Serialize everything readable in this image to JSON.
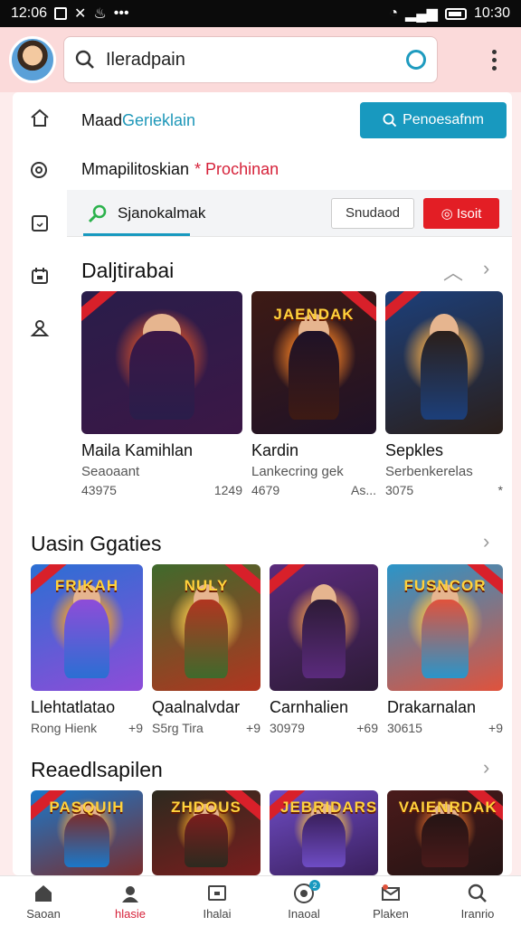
{
  "status_bar": {
    "time_left": "12:06",
    "time": "10:30",
    "dots": "•••"
  },
  "search": {
    "query": "Ileradpain"
  },
  "rail": {
    "items": [
      "home-icon",
      "search-icon",
      "tablet-icon",
      "calendar-icon",
      "user-icon"
    ]
  },
  "header_rows": {
    "row1_prefix": "Maad",
    "row1_link": "Gerieklain",
    "row1_button": "Penoesafnm",
    "row2_label": "Mmapilitoskian",
    "row2_red": "* Prochinan",
    "row3_label": "Sjanokalmak",
    "row3_btn_white": "Snudaod",
    "row3_btn_red": "Isoit"
  },
  "sections": [
    {
      "title": "Daljtirabai",
      "cards": [
        {
          "name": "Maila Kamihlan",
          "sub": "Seaoaant",
          "stat_left": "43975",
          "stat_right": "1249",
          "thumb_title": "",
          "colors": [
            "#2a1d4a",
            "#d6512b",
            "#3b1746"
          ]
        },
        {
          "name": "Kardin",
          "sub": "Lankecring gek",
          "stat_left": "4679",
          "stat_right": "As...",
          "thumb_title": "JAENDAK",
          "colors": [
            "#3d1a14",
            "#ec7b24",
            "#1f1227"
          ]
        },
        {
          "name": "Sepkles",
          "sub": "Serbenkerelas",
          "stat_left": "3075",
          "stat_right": "*",
          "thumb_title": "",
          "colors": [
            "#1c3f7a",
            "#e0a049",
            "#2b1f1a"
          ]
        }
      ]
    },
    {
      "title": "Uasin Ggaties",
      "cards": [
        {
          "name": "Llehtatlatao",
          "sub": "Rong Hienk",
          "stat_left": "",
          "stat_right": "+9",
          "thumb_title": "FRIKAH",
          "colors": [
            "#2b6fd3",
            "#f2a32a",
            "#8e4cd8"
          ]
        },
        {
          "name": "Qaalnalvdar",
          "sub": "S5rg Tira",
          "stat_left": "",
          "stat_right": "+9",
          "thumb_title": "NULY",
          "colors": [
            "#3f6a2c",
            "#f0c24a",
            "#b13520"
          ]
        },
        {
          "name": "Carnhalien",
          "sub": "30979",
          "stat_left": "",
          "stat_right": "+69",
          "thumb_title": "",
          "colors": [
            "#5a2a7c",
            "#d98a4e",
            "#2d1b36"
          ]
        },
        {
          "name": "Drakarnalan",
          "sub": "30615",
          "stat_left": "",
          "stat_right": "+9",
          "thumb_title": "FUSNCOR",
          "colors": [
            "#2a95c9",
            "#f6c24c",
            "#e0523c"
          ]
        }
      ]
    },
    {
      "title": "Reaedlsapilen",
      "cards": [
        {
          "thumb_title": "PASQUIH",
          "colors": [
            "#1b78c9",
            "#e6a34a",
            "#7a2d2d"
          ]
        },
        {
          "thumb_title": "ZHDOUS",
          "colors": [
            "#2d2a1f",
            "#f0a628",
            "#7b1d1d"
          ]
        },
        {
          "thumb_title": "JEBRIDARS",
          "colors": [
            "#6e4cc4",
            "#f5c04a",
            "#3a1f5c"
          ]
        },
        {
          "thumb_title": "VAIENRDAK",
          "colors": [
            "#4a1a1a",
            "#d86a2a",
            "#241414"
          ]
        }
      ]
    }
  ],
  "bottom_nav": [
    {
      "label": "Saoan",
      "icon": "home-icon"
    },
    {
      "label": "hlasie",
      "icon": "user-icon",
      "active": true
    },
    {
      "label": "Ihalai",
      "icon": "tablet-icon"
    },
    {
      "label": "Inaoal",
      "icon": "compass-icon",
      "badge": "2"
    },
    {
      "label": "Plaken",
      "icon": "mail-icon"
    },
    {
      "label": "Iranrio",
      "icon": "search-icon"
    }
  ],
  "colors": {
    "accent": "#1899bf",
    "danger": "#e31e25",
    "appbar": "#fbdada"
  }
}
